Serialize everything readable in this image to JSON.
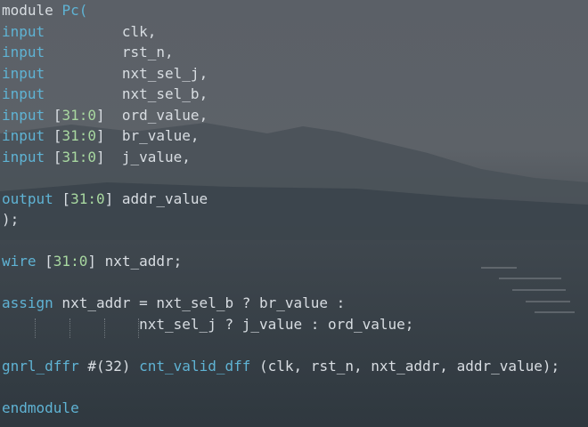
{
  "editor": {
    "lines": [
      {
        "segments": [
          {
            "text": "module ",
            "role": "plain"
          },
          {
            "text": "Pc(",
            "role": "kw"
          }
        ]
      },
      {
        "segments": [
          {
            "text": "input",
            "role": "kw"
          },
          {
            "text": "         clk,",
            "role": "plain"
          }
        ]
      },
      {
        "segments": [
          {
            "text": "input",
            "role": "kw"
          },
          {
            "text": "         rst_n,",
            "role": "plain"
          }
        ]
      },
      {
        "segments": [
          {
            "text": "input",
            "role": "kw"
          },
          {
            "text": "         nxt_sel_j,",
            "role": "plain"
          }
        ]
      },
      {
        "segments": [
          {
            "text": "input",
            "role": "kw"
          },
          {
            "text": "         nxt_sel_b,",
            "role": "plain"
          }
        ]
      },
      {
        "segments": [
          {
            "text": "input",
            "role": "kw"
          },
          {
            "text": " [",
            "role": "plain"
          },
          {
            "text": "31:0",
            "role": "num"
          },
          {
            "text": "]  ord_value,",
            "role": "plain"
          }
        ]
      },
      {
        "segments": [
          {
            "text": "input",
            "role": "kw"
          },
          {
            "text": " [",
            "role": "plain"
          },
          {
            "text": "31:0",
            "role": "num"
          },
          {
            "text": "]  br_value,",
            "role": "plain"
          }
        ]
      },
      {
        "segments": [
          {
            "text": "input",
            "role": "kw"
          },
          {
            "text": " [",
            "role": "plain"
          },
          {
            "text": "31:0",
            "role": "num"
          },
          {
            "text": "]  j_value,",
            "role": "plain"
          }
        ]
      },
      {
        "segments": []
      },
      {
        "segments": [
          {
            "text": "output",
            "role": "kw"
          },
          {
            "text": " [",
            "role": "plain"
          },
          {
            "text": "31:0",
            "role": "num"
          },
          {
            "text": "] addr_value",
            "role": "plain"
          }
        ]
      },
      {
        "segments": [
          {
            "text": ");",
            "role": "plain"
          }
        ]
      },
      {
        "segments": []
      },
      {
        "segments": [
          {
            "text": "wire",
            "role": "kw"
          },
          {
            "text": " [",
            "role": "plain"
          },
          {
            "text": "31:0",
            "role": "num"
          },
          {
            "text": "] nxt_addr;",
            "role": "plain"
          }
        ]
      },
      {
        "segments": []
      },
      {
        "segments": [
          {
            "text": "assign",
            "role": "kw"
          },
          {
            "text": " nxt_addr = nxt_sel_b ? br_value :",
            "role": "plain"
          }
        ]
      },
      {
        "segments": [
          {
            "text": "                nxt_sel_j ? j_value : ord_value;",
            "role": "plain"
          }
        ]
      },
      {
        "segments": []
      },
      {
        "segments": [
          {
            "text": "gnrl_dffr",
            "role": "kw"
          },
          {
            "text": " #(32) ",
            "role": "plain"
          },
          {
            "text": "cnt_valid_dff",
            "role": "kw"
          },
          {
            "text": " (clk, rst_n, nxt_addr, addr_value);",
            "role": "plain"
          }
        ]
      },
      {
        "segments": []
      },
      {
        "segments": [
          {
            "text": "endmodule",
            "role": "kw"
          }
        ]
      }
    ]
  },
  "colors": {
    "keyword": "#5fb3d4",
    "number": "#a8d8a0",
    "text": "#d8dde2"
  }
}
